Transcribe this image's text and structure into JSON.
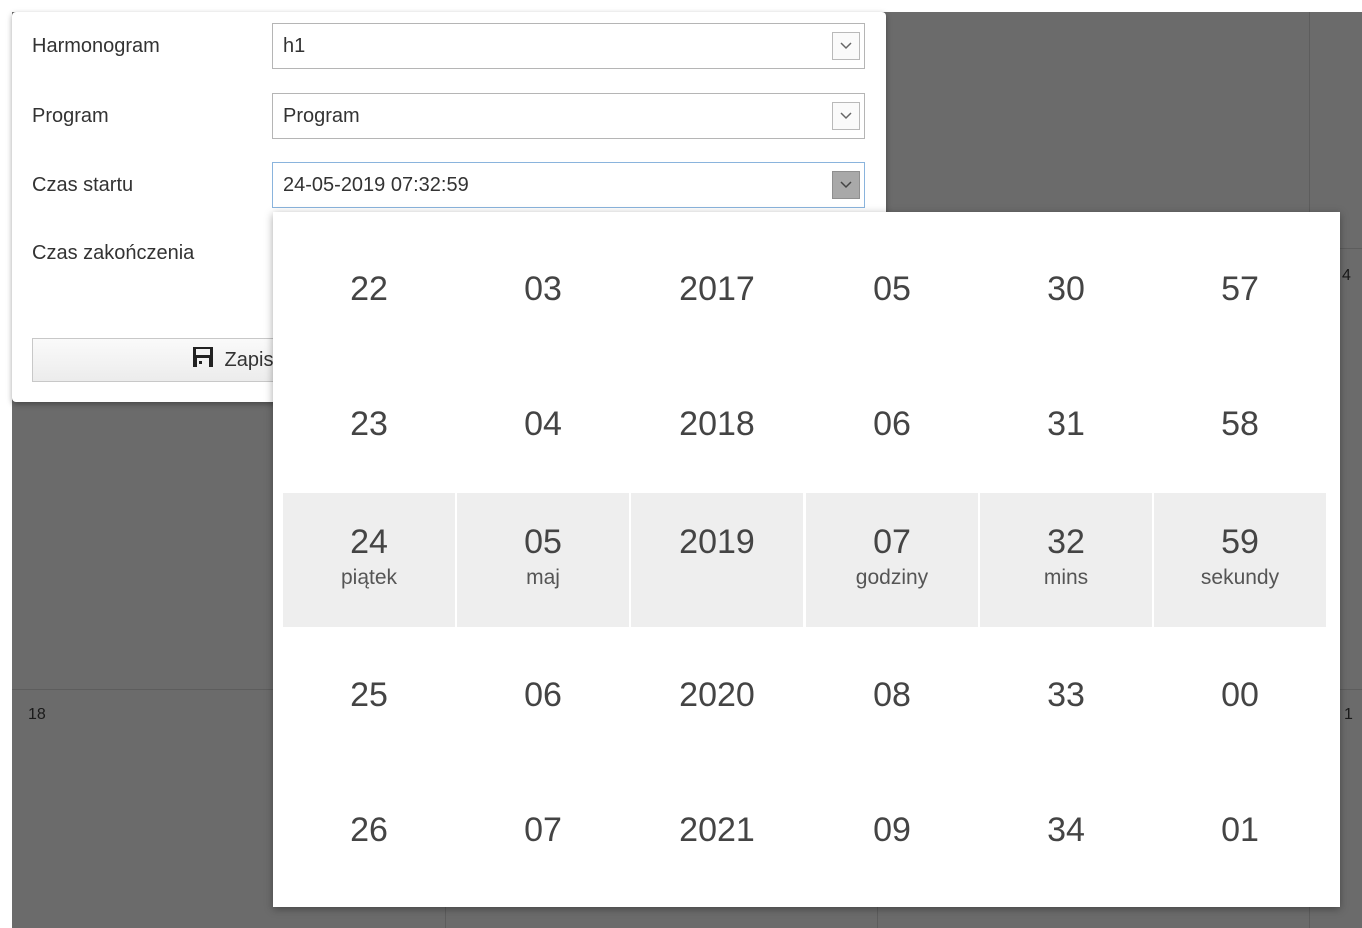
{
  "form": {
    "fields": [
      {
        "label": "Harmonogram",
        "value": "h1"
      },
      {
        "label": "Program",
        "value": "Program"
      },
      {
        "label": "Czas startu",
        "value": "24-05-2019 07:32:59"
      },
      {
        "label": "Czas zakończenia"
      }
    ],
    "save_label": "Zapis"
  },
  "background": {
    "day_numbers": [
      "18",
      "4",
      "1"
    ]
  },
  "picker": {
    "columns": [
      {
        "name": "day",
        "items": [
          {
            "value": "22"
          },
          {
            "value": "23"
          },
          {
            "value": "24",
            "unit": "piątek",
            "selected": true
          },
          {
            "value": "25"
          },
          {
            "value": "26"
          }
        ]
      },
      {
        "name": "month",
        "items": [
          {
            "value": "03"
          },
          {
            "value": "04"
          },
          {
            "value": "05",
            "unit": "maj",
            "selected": true
          },
          {
            "value": "06"
          },
          {
            "value": "07"
          }
        ]
      },
      {
        "name": "year",
        "items": [
          {
            "value": "2017"
          },
          {
            "value": "2018"
          },
          {
            "value": "2019",
            "unit": "",
            "selected": true
          },
          {
            "value": "2020"
          },
          {
            "value": "2021"
          }
        ]
      },
      {
        "name": "hour",
        "items": [
          {
            "value": "05"
          },
          {
            "value": "06"
          },
          {
            "value": "07",
            "unit": "godziny",
            "selected": true
          },
          {
            "value": "08"
          },
          {
            "value": "09"
          }
        ]
      },
      {
        "name": "minute",
        "items": [
          {
            "value": "30"
          },
          {
            "value": "31"
          },
          {
            "value": "32",
            "unit": "mins",
            "selected": true
          },
          {
            "value": "33"
          },
          {
            "value": "34"
          }
        ]
      },
      {
        "name": "second",
        "items": [
          {
            "value": "57"
          },
          {
            "value": "58"
          },
          {
            "value": "59",
            "unit": "sekundy",
            "selected": true
          },
          {
            "value": "00"
          },
          {
            "value": "01"
          }
        ]
      }
    ]
  },
  "colors": {
    "backdrop": "#6b6b6b",
    "selected_row": "#eeeeee",
    "active_border": "#8ab4dd"
  },
  "icons": {
    "dropdown": "chevron-down-icon",
    "save": "floppy-disk-icon"
  }
}
